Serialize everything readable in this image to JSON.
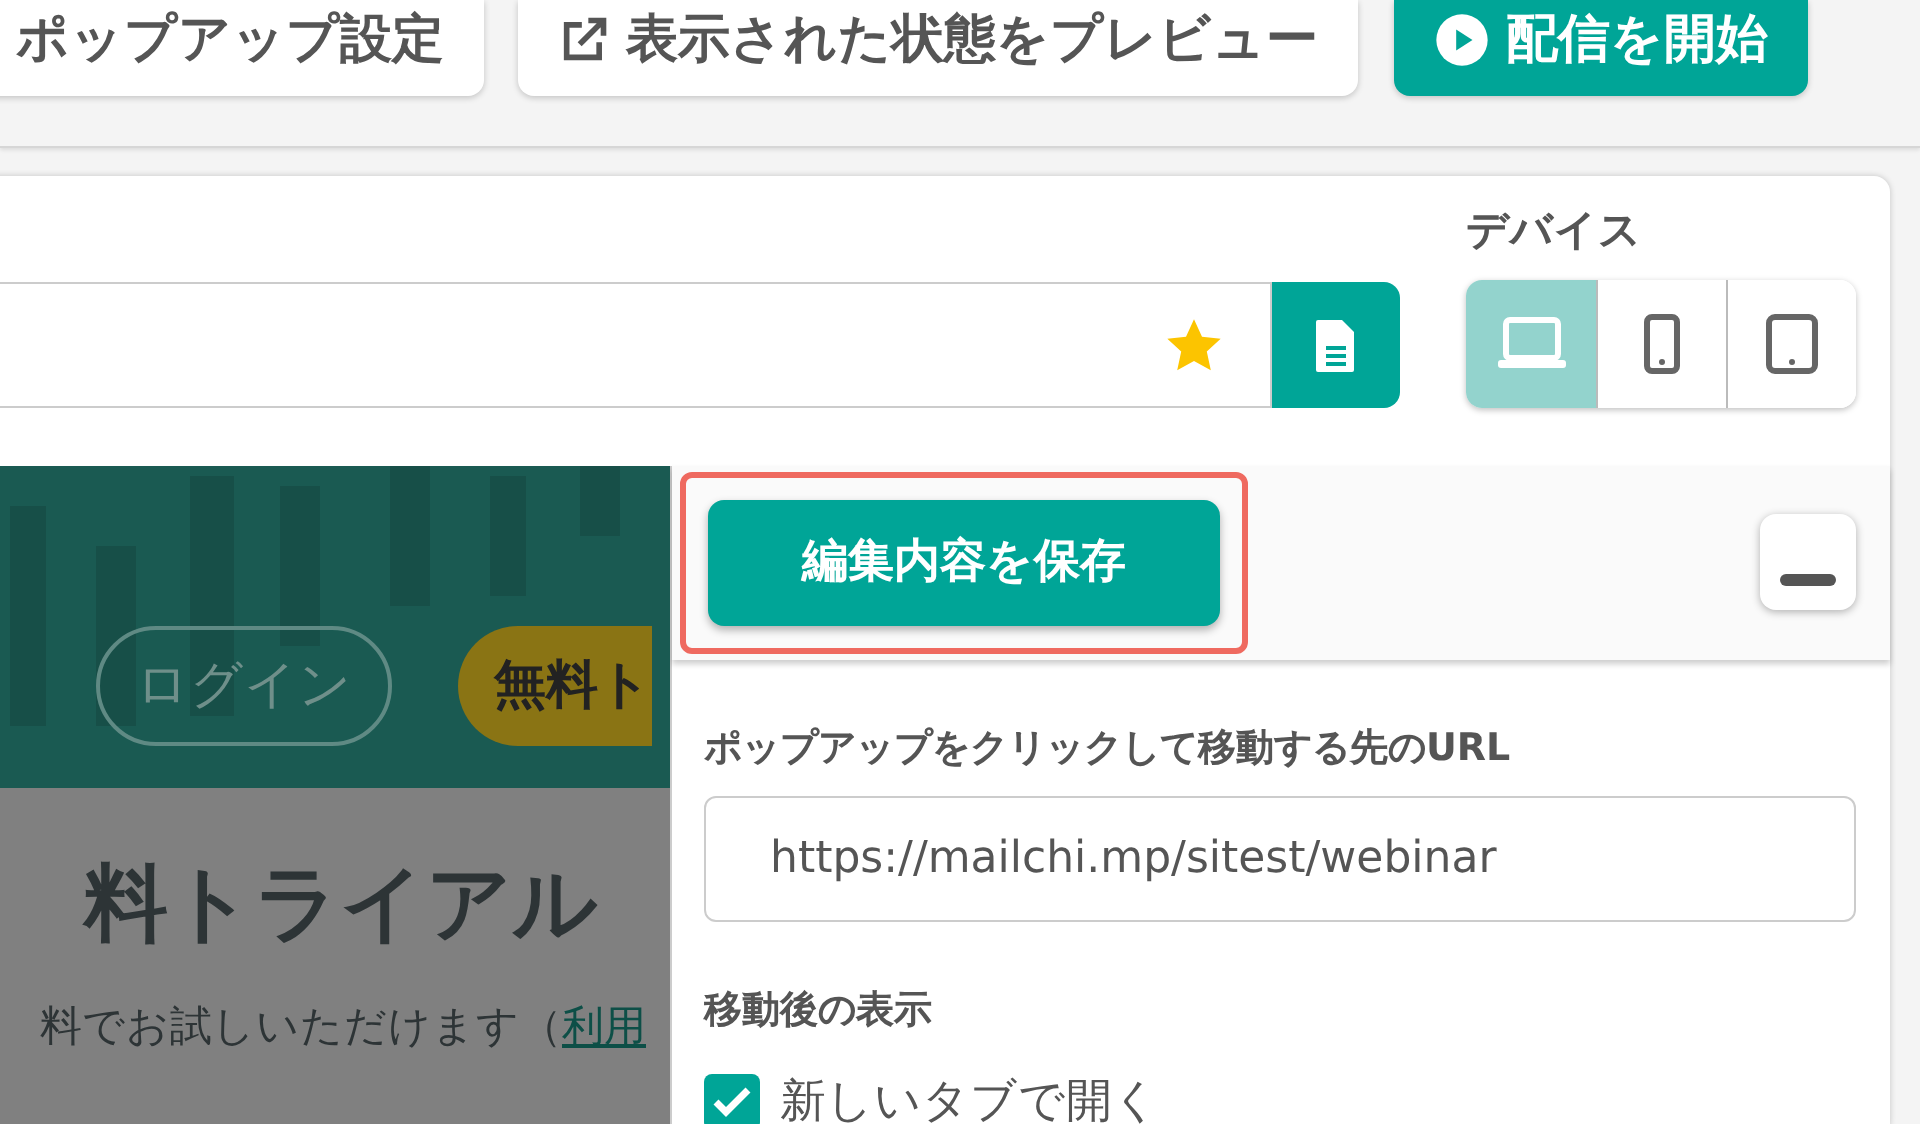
{
  "toolbar": {
    "buttons": [
      {
        "label": "ポップアップ設定",
        "kind": "plain"
      },
      {
        "label": "表示された状態をプレビュー",
        "kind": "preview"
      },
      {
        "label": "配信を開始",
        "kind": "primary"
      }
    ]
  },
  "url_bar": {
    "starred": true
  },
  "device": {
    "label": "デバイス",
    "options": [
      {
        "kind": "laptop",
        "selected": true
      },
      {
        "kind": "phone",
        "selected": false
      },
      {
        "kind": "tablet",
        "selected": false
      }
    ]
  },
  "preview": {
    "login": "ログイン",
    "trial_button": "無料ト",
    "heading": "料トライアル",
    "text": "料でお試しいただけます（",
    "link": "利用"
  },
  "panel": {
    "save_button": "編集内容を保存",
    "highlighted": true,
    "url_label": "ポップアップをクリックして移動する先のURL",
    "url_value": "https://mailchi.mp/sitest/webinar",
    "after_label": "移動後の表示",
    "new_tab": {
      "label": "新しいタブで開く",
      "checked": true
    }
  }
}
